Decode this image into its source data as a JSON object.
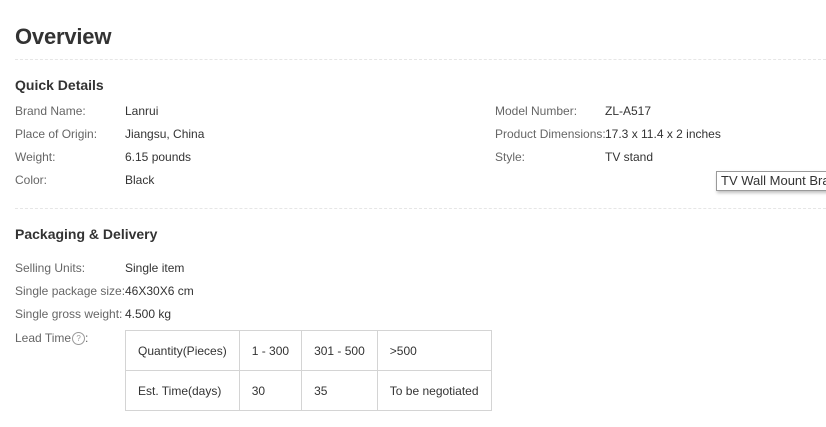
{
  "page_title": "Overview",
  "quick_details": {
    "title": "Quick Details",
    "left": [
      {
        "label": "Brand Name:",
        "value": "Lanrui"
      },
      {
        "label": "Place of Origin:",
        "value": "Jiangsu, China"
      },
      {
        "label": "Weight:",
        "value": "6.15 pounds"
      },
      {
        "label": "Color:",
        "value": "Black"
      }
    ],
    "right": [
      {
        "label": "Model Number:",
        "value": "ZL-A517"
      },
      {
        "label": "Product Dimensions:",
        "value": "17.3 x 11.4 x 2 inches"
      },
      {
        "label": "Style:",
        "value": "TV stand"
      }
    ],
    "tooltip": "TV Wall Mount Bra"
  },
  "packaging": {
    "title": "Packaging & Delivery",
    "rows": [
      {
        "label": "Selling Units:",
        "value": "Single item"
      },
      {
        "label": "Single package size:",
        "value": "46X30X6 cm"
      },
      {
        "label": "Single gross weight:",
        "value": "4.500 kg"
      }
    ],
    "lead_time": {
      "label": "Lead Time",
      "help_icon": "question-circle-icon",
      "help_glyph": "?",
      "suffix": ":",
      "headers": [
        "Quantity(Pieces)",
        "1 - 300",
        "301 - 500",
        ">500"
      ],
      "values": [
        "Est. Time(days)",
        "30",
        "35",
        "To be negotiated"
      ]
    }
  }
}
